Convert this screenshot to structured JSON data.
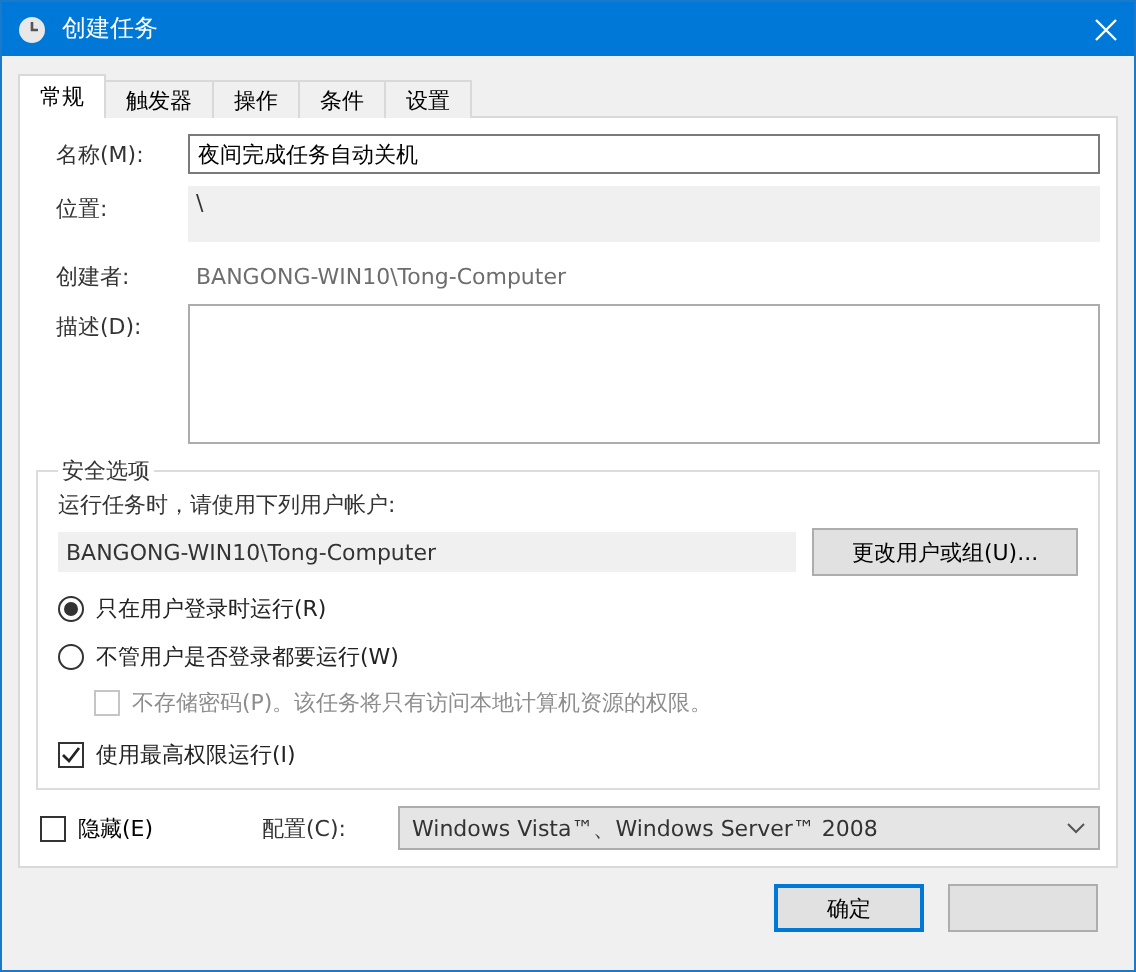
{
  "window": {
    "title": "创建任务"
  },
  "tabs": [
    {
      "label": "常规",
      "selected": true
    },
    {
      "label": "触发器",
      "selected": false
    },
    {
      "label": "操作",
      "selected": false
    },
    {
      "label": "条件",
      "selected": false
    },
    {
      "label": "设置",
      "selected": false
    }
  ],
  "general": {
    "name_label": "名称(M):",
    "name_value": "夜间完成任务自动关机",
    "location_label": "位置:",
    "location_value": "\\",
    "author_label": "创建者:",
    "author_value": "BANGONG-WIN10\\Tong-Computer",
    "description_label": "描述(D):"
  },
  "security": {
    "title": "安全选项",
    "account_prompt": "运行任务时，请使用下列用户帐户:",
    "account": "BANGONG-WIN10\\Tong-Computer",
    "change_button": "更改用户或组(U)...",
    "run_options": [
      {
        "label": "只在用户登录时运行(R)",
        "selected": true
      },
      {
        "label": "不管用户是否登录都要运行(W)",
        "selected": false
      }
    ],
    "no_store_password": {
      "label": "不存储密码(P)。该任务将只有访问本地计算机资源的权限。",
      "checked": false,
      "disabled": true
    },
    "highest_privileges": {
      "label": "使用最高权限运行(I)",
      "checked": true
    }
  },
  "hidden": {
    "label": "隐藏(E)",
    "checked": false
  },
  "configure": {
    "label": "配置(C):",
    "value": "Windows Vista™、Windows Server™ 2008"
  },
  "buttons": [
    {
      "label": "确定",
      "kind": "default"
    },
    {
      "kind": "plain"
    }
  ]
}
